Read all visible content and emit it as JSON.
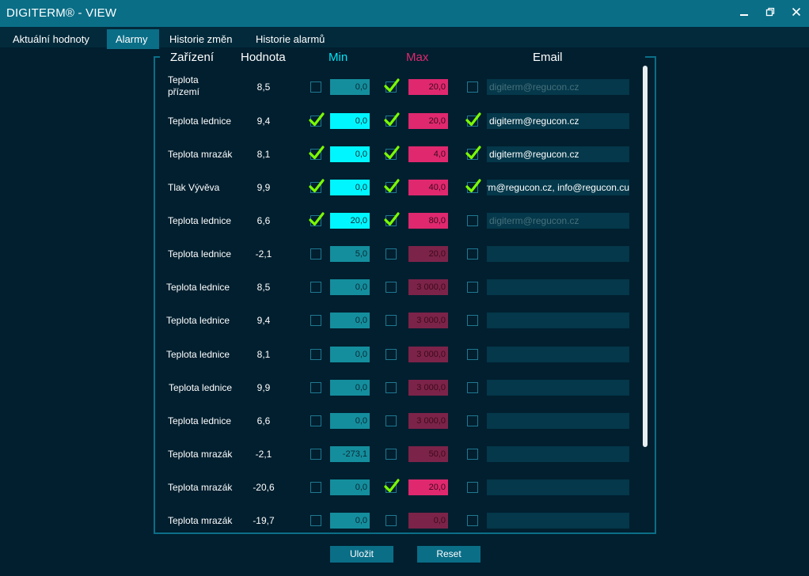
{
  "window": {
    "title": "DIGITERM® - VIEW"
  },
  "tabs": [
    {
      "label": "Aktuální hodnoty"
    },
    {
      "label": "Alarmy"
    },
    {
      "label": "Historie změn"
    },
    {
      "label": "Historie alarmů"
    }
  ],
  "headers": {
    "device": "Zařízení",
    "value": "Hodnota",
    "min": "Min",
    "max": "Max",
    "email": "Email"
  },
  "colors": {
    "accent": "#0a6e87",
    "min_header": "#00e5f5",
    "max_header": "#e0286f",
    "check": "#7cfc00"
  },
  "rows": [
    {
      "device": "Teplota\npřízemí",
      "value": "8,5",
      "min_checked": false,
      "min": "0,0",
      "max_checked": true,
      "max": "20,0",
      "email_checked": false,
      "email": "digiterm@regucon.cz"
    },
    {
      "device": "Teplota lednice",
      "value": "9,4",
      "min_checked": true,
      "min": "0,0",
      "max_checked": true,
      "max": "20,0",
      "email_checked": true,
      "email": "digiterm@regucon.cz"
    },
    {
      "device": "Teplota mrazák",
      "value": "8,1",
      "min_checked": true,
      "min": "0,0",
      "max_checked": true,
      "max": "4,0",
      "email_checked": true,
      "email": "digiterm@regucon.cz"
    },
    {
      "device": "Tlak Vývěva",
      "value": "9,9",
      "min_checked": true,
      "min": "0,0",
      "max_checked": true,
      "max": "40,0",
      "email_checked": true,
      "email": "rm@regucon.cz, info@regucon.cu"
    },
    {
      "device": "Teplota lednice",
      "value": "6,6",
      "min_checked": true,
      "min": "20,0",
      "max_checked": true,
      "max": "80,0",
      "email_checked": false,
      "email": "digiterm@regucon.cz"
    },
    {
      "device": "Teplota lednice",
      "value": "-2,1",
      "min_checked": false,
      "min": "5,0",
      "max_checked": false,
      "max": "20,0",
      "email_checked": false,
      "email": ""
    },
    {
      "device": "Teplota lednice",
      "value": "8,5",
      "min_checked": false,
      "min": "0,0",
      "max_checked": false,
      "max": "3 000,0",
      "email_checked": false,
      "email": ""
    },
    {
      "device": "Teplota lednice",
      "value": "9,4",
      "min_checked": false,
      "min": "0,0",
      "max_checked": false,
      "max": "3 000,0",
      "email_checked": false,
      "email": ""
    },
    {
      "device": "Teplota lednice",
      "value": "8,1",
      "min_checked": false,
      "min": "0,0",
      "max_checked": false,
      "max": "3 000,0",
      "email_checked": false,
      "email": ""
    },
    {
      "device": "Teplota lednice",
      "value": "9,9",
      "min_checked": false,
      "min": "0,0",
      "max_checked": false,
      "max": "3 000,0",
      "email_checked": false,
      "email": ""
    },
    {
      "device": "Teplota lednice",
      "value": "6,6",
      "min_checked": false,
      "min": "0,0",
      "max_checked": false,
      "max": "3 000,0",
      "email_checked": false,
      "email": ""
    },
    {
      "device": "Teplota mrazák",
      "value": "-2,1",
      "min_checked": false,
      "min": "-273,1",
      "max_checked": false,
      "max": "50,0",
      "email_checked": false,
      "email": ""
    },
    {
      "device": "Teplota mrazák",
      "value": "-20,6",
      "min_checked": false,
      "min": "0,0",
      "max_checked": true,
      "max": "20,0",
      "email_checked": false,
      "email": ""
    },
    {
      "device": "Teplota mrazák",
      "value": "-19,7",
      "min_checked": false,
      "min": "0,0",
      "max_checked": false,
      "max": "0,0",
      "email_checked": false,
      "email": ""
    }
  ],
  "buttons": {
    "save": "Uložit",
    "reset": "Reset"
  }
}
